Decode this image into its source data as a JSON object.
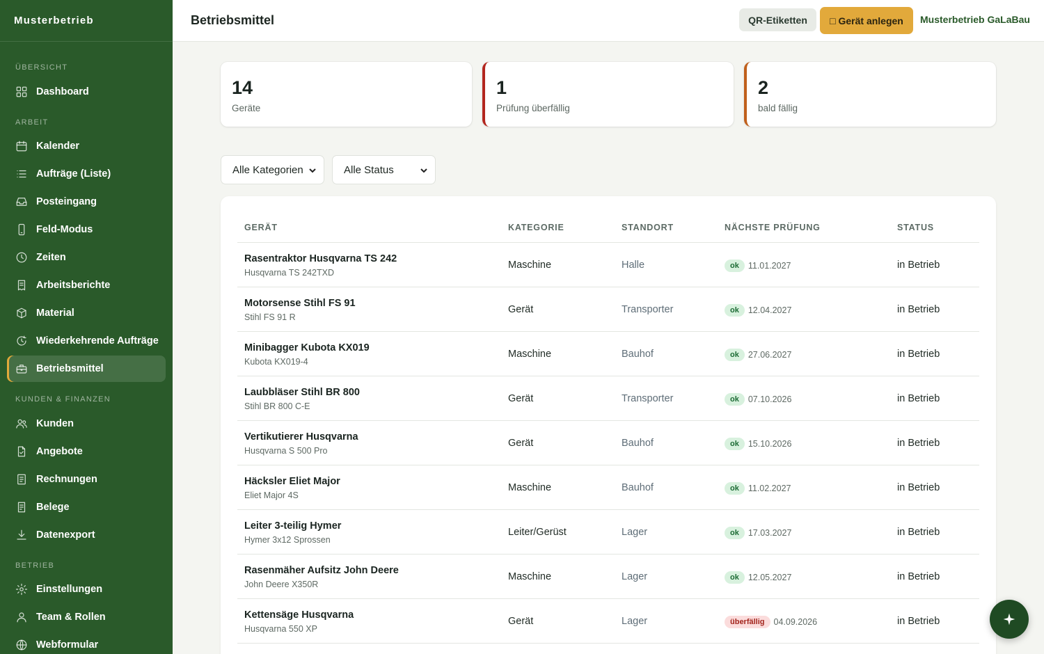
{
  "sidebar": {
    "brand": "Musterbetrieb",
    "sections": [
      {
        "label": "ÜBERSICHT"
      },
      {
        "label": "ARBEIT"
      },
      {
        "label": "KUNDEN & FINANZEN"
      },
      {
        "label": "BETRIEB"
      }
    ],
    "items": [
      {
        "label": "Dashboard",
        "icon": "grid-icon"
      },
      {
        "label": "Kalender",
        "icon": "calendar-icon"
      },
      {
        "label": "Aufträge (Liste)",
        "icon": "list-icon"
      },
      {
        "label": "Posteingang",
        "icon": "inbox-icon"
      },
      {
        "label": "Feld-Modus",
        "icon": "phone-icon"
      },
      {
        "label": "Zeiten",
        "icon": "clock-icon"
      },
      {
        "label": "Arbeitsberichte",
        "icon": "report-icon"
      },
      {
        "label": "Material",
        "icon": "box-icon"
      },
      {
        "label": "Wiederkehrende Aufträge",
        "icon": "recurring-icon"
      },
      {
        "label": "Betriebsmittel",
        "icon": "toolbox-icon",
        "active": true
      },
      {
        "label": "Kunden",
        "icon": "users-icon"
      },
      {
        "label": "Angebote",
        "icon": "file-icon"
      },
      {
        "label": "Rechnungen",
        "icon": "invoice-icon"
      },
      {
        "label": "Belege",
        "icon": "receipt-icon"
      },
      {
        "label": "Datenexport",
        "icon": "download-icon"
      },
      {
        "label": "Einstellungen",
        "icon": "settings-icon"
      },
      {
        "label": "Team & Rollen",
        "icon": "user-icon"
      },
      {
        "label": "Webformular",
        "icon": "globe-icon"
      }
    ]
  },
  "header": {
    "title": "Betriebsmittel",
    "qr_label": "QR-Etiketten",
    "add_label": "□ Gerät anlegen",
    "company": "Musterbetrieb GaLaBau"
  },
  "stats": [
    {
      "value": "14",
      "label": "Geräte"
    },
    {
      "value": "1",
      "label": "Prüfung überfällig"
    },
    {
      "value": "2",
      "label": "bald fällig"
    }
  ],
  "filters": {
    "category": "Alle Kategorien",
    "status": "Alle Status"
  },
  "table": {
    "columns": [
      "GERÄT",
      "KATEGORIE",
      "STANDORT",
      "NÄCHSTE PRÜFUNG",
      "STATUS"
    ],
    "rows": [
      {
        "name": "Rasentraktor Husqvarna TS 242",
        "model": "Husqvarna TS 242TXD",
        "category": "Maschine",
        "location": "Halle",
        "badge": "ok",
        "due": "11.01.2027",
        "status": "in Betrieb"
      },
      {
        "name": "Motorsense Stihl FS 91",
        "model": "Stihl FS 91 R",
        "category": "Gerät",
        "location": "Transporter",
        "badge": "ok",
        "due": "12.04.2027",
        "status": "in Betrieb"
      },
      {
        "name": "Minibagger Kubota KX019",
        "model": "Kubota KX019-4",
        "category": "Maschine",
        "location": "Bauhof",
        "badge": "ok",
        "due": "27.06.2027",
        "status": "in Betrieb"
      },
      {
        "name": "Laubbläser Stihl BR 800",
        "model": "Stihl BR 800 C-E",
        "category": "Gerät",
        "location": "Transporter",
        "badge": "ok",
        "due": "07.10.2026",
        "status": "in Betrieb"
      },
      {
        "name": "Vertikutierer Husqvarna",
        "model": "Husqvarna S 500 Pro",
        "category": "Gerät",
        "location": "Bauhof",
        "badge": "ok",
        "due": "15.10.2026",
        "status": "in Betrieb"
      },
      {
        "name": "Häcksler Eliet Major",
        "model": "Eliet Major 4S",
        "category": "Maschine",
        "location": "Bauhof",
        "badge": "ok",
        "due": "11.02.2027",
        "status": "in Betrieb"
      },
      {
        "name": "Leiter 3-teilig Hymer",
        "model": "Hymer 3x12 Sprossen",
        "category": "Leiter/Gerüst",
        "location": "Lager",
        "badge": "ok",
        "due": "17.03.2027",
        "status": "in Betrieb"
      },
      {
        "name": "Rasenmäher Aufsitz John Deere",
        "model": "John Deere X350R",
        "category": "Maschine",
        "location": "Lager",
        "badge": "ok",
        "due": "12.05.2027",
        "status": "in Betrieb"
      },
      {
        "name": "Kettensäge Husqvarna",
        "model": "Husqvarna 550 XP",
        "category": "Gerät",
        "location": "Lager",
        "badge": "überfällig",
        "due": "04.09.2026",
        "status": "in Betrieb"
      }
    ]
  },
  "fab_icon": "sparkle-icon"
}
